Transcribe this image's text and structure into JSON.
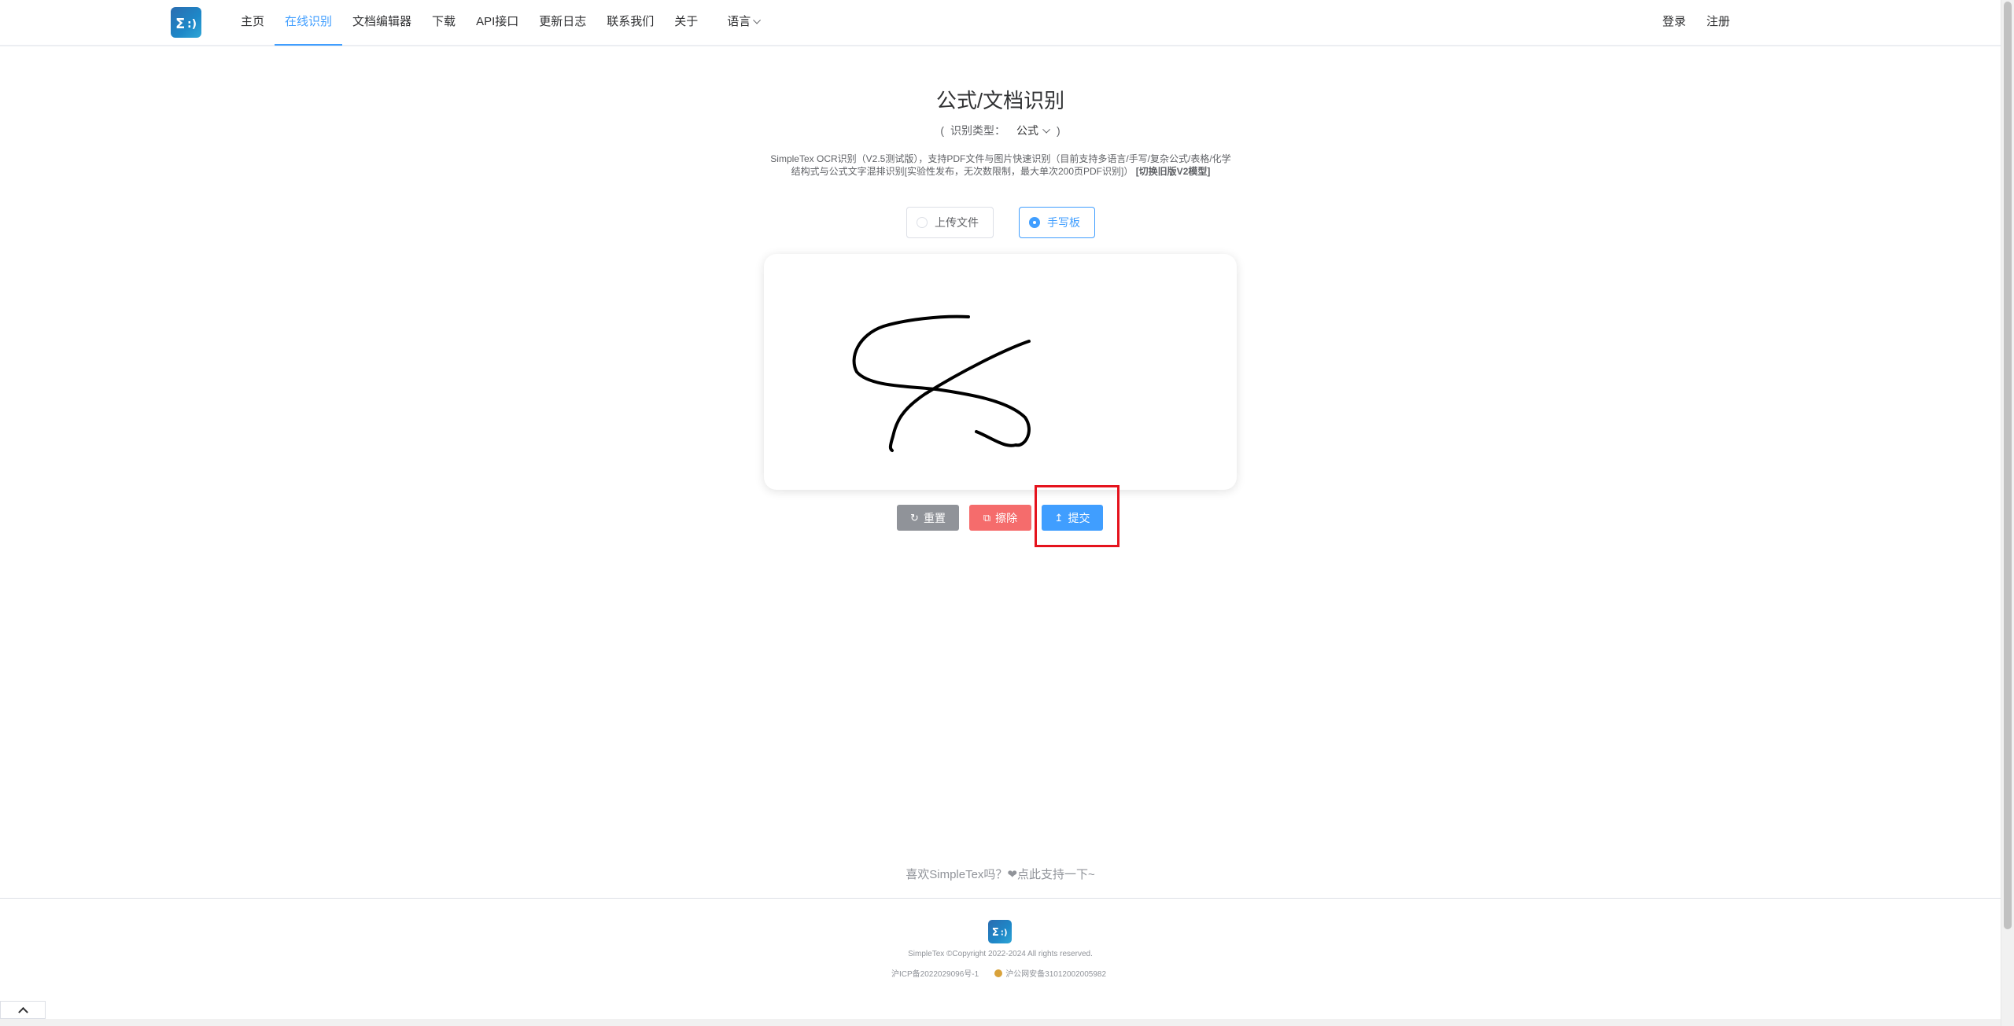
{
  "nav": {
    "items": [
      {
        "label": "主页",
        "active": false
      },
      {
        "label": "在线识别",
        "active": true
      },
      {
        "label": "文档编辑器",
        "active": false
      },
      {
        "label": "下载",
        "active": false
      },
      {
        "label": "API接口",
        "active": false
      },
      {
        "label": "更新日志",
        "active": false
      },
      {
        "label": "联系我们",
        "active": false
      },
      {
        "label": "关于",
        "active": false
      }
    ],
    "language_label": "语言",
    "login_label": "登录",
    "register_label": "注册"
  },
  "main": {
    "title": "公式/文档识别",
    "type_label": "识别类型：",
    "type_value": "公式",
    "description": "SimpleTex OCR识别（V2.5测试版），支持PDF文件与图片快速识别（目前支持多语言/手写/复杂公式/表格/化学结构式与公式文字混排识别[实验性发布，无次数限制，最大单次200页PDF识别]）",
    "description_link": "[切换旧版V2模型]",
    "modes": [
      {
        "label": "上传文件",
        "checked": false
      },
      {
        "label": "手写板",
        "checked": true
      }
    ],
    "buttons": {
      "reset": "重置",
      "clear": "擦除",
      "submit": "提交"
    }
  },
  "footer": {
    "support_text": "喜欢SimpleTex吗？❤点此支持一下~",
    "copyright": "SimpleTex ©Copyright 2022-2024 All rights reserved.",
    "icp": "沪ICP备2022029096号-1",
    "police": "沪公网安备31012002005982"
  },
  "colors": {
    "primary": "#409eff",
    "danger": "#f56c6c",
    "info": "#909399",
    "highlight": "#e5131d"
  }
}
